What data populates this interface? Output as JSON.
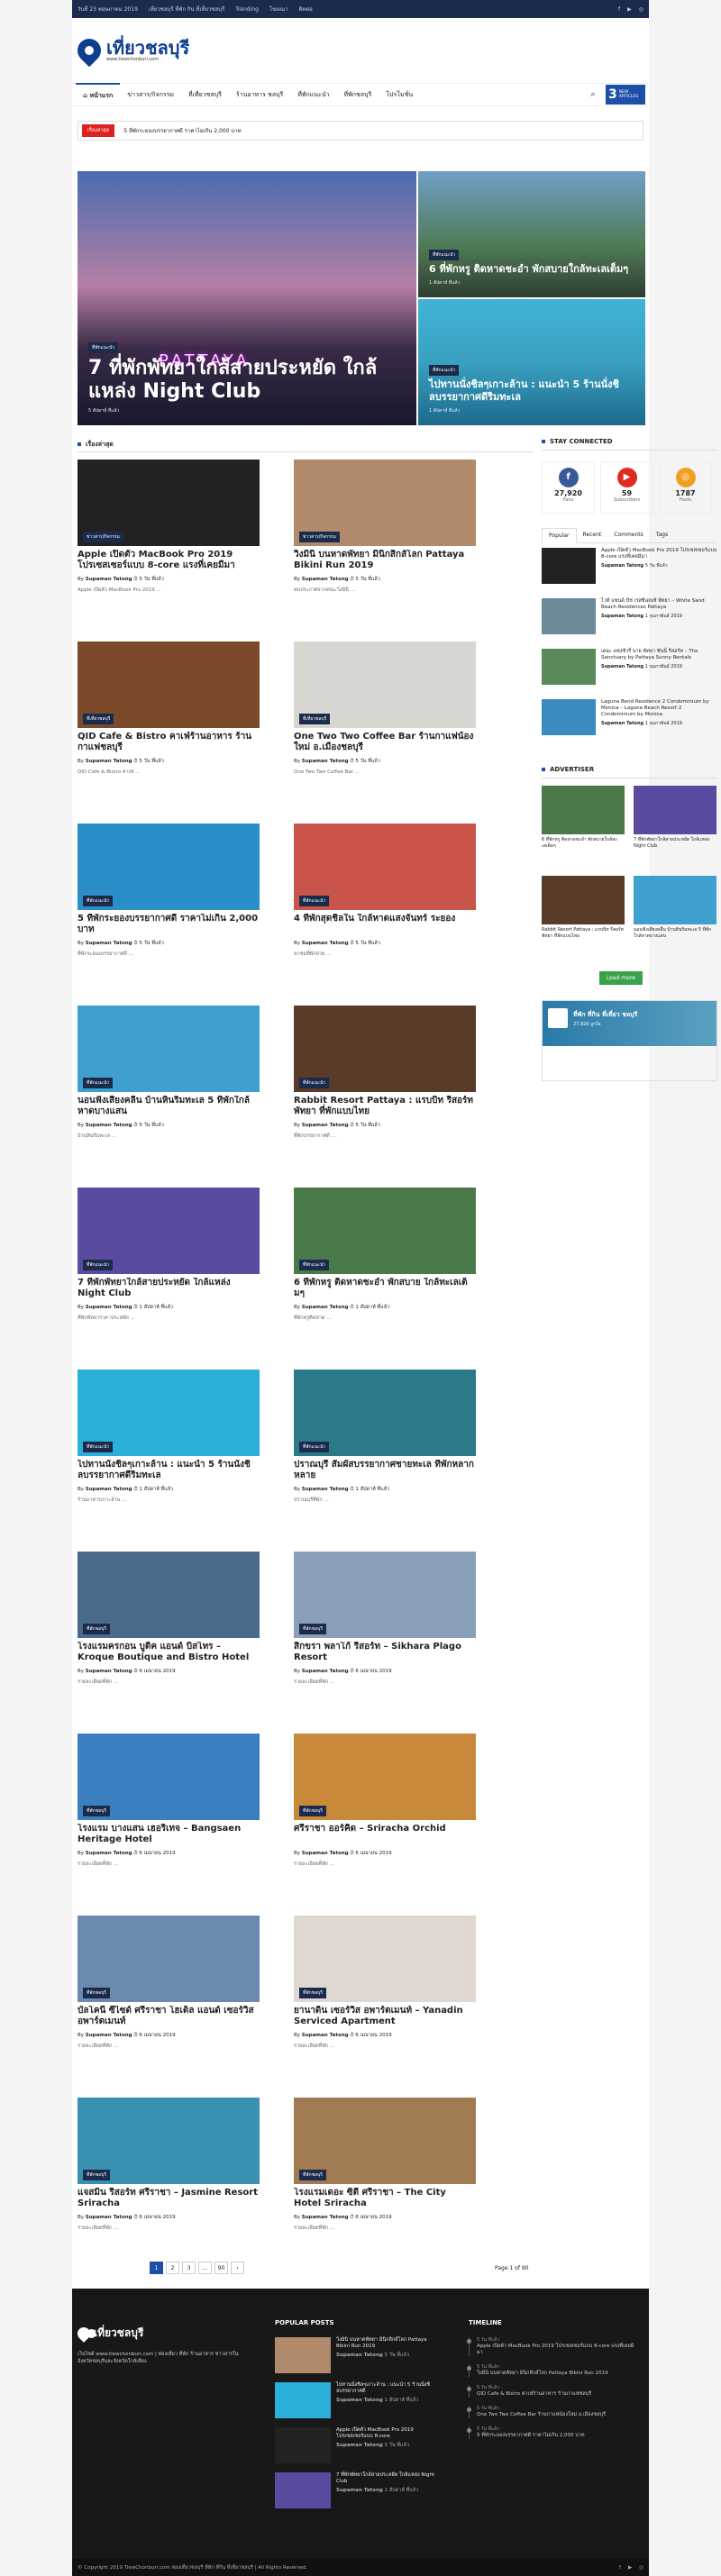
{
  "topbar": {
    "date": "วันที่ 23 พฤษภาคม 2019",
    "tagline": "เที่ยวชลบุรี ที่พัก กิน ที่เที่ยวชลบุรี",
    "trending": "Trending",
    "links": [
      "โฆษณา",
      "ติดต่อ"
    ]
  },
  "logo": {
    "title": "เที่ยวชลบุรี",
    "sub": "www.tiewchonburi.com"
  },
  "nav": {
    "items": [
      "หน้าแรก",
      "ข่าวสาร/กิจกรรม",
      "ที่เที่ยวชลบุรี",
      "ร้านอาหาร ชลบุรี",
      "ที่พักแนะนำ",
      "ที่พักชลบุรี",
      "โปรโมชั่น"
    ],
    "new_count": "3",
    "new_label": "NEW ARTICLES"
  },
  "ticker": {
    "label": "เรื่องล่าสุด",
    "text": "5 ที่พักระยองบรรยากาศดี ราคาไม่เกิน 2,000 บาท"
  },
  "hero": [
    {
      "cat": "ที่พักแนะนำ",
      "title": "7 ที่พักพัทยาใกล้สายประหยัด ใกล้แหล่ง Night Club",
      "meta": "5 สัปดาห์ ที่แล้ว",
      "sign": "PATTAYA"
    },
    {
      "cat": "ที่พักแนะนำ",
      "title": "6 ที่พักหรู ติดหาดชะอำ พักสบายใกล้ทะเลเต็มๆ",
      "meta": "1 สัปดาห์ ที่แล้ว"
    },
    {
      "cat": "ที่พักแนะนำ",
      "title": "ไปทานนั่งชิลๆเกาะล้าน : แนะนำ 5 ร้านนั่งชิลบรรยากาศดีริมทะเล",
      "meta": "1 สัปดาห์ ที่แล้ว"
    }
  ],
  "latest_heading": "เรื่องล่าสุด",
  "posts": [
    {
      "cat": "ข่าวสาร/กิจกรรม",
      "title": "Apple เปิดตัว MacBook Pro 2019 โปรเซสเซอร์แบบ 8-core แรงที่เคยมีมา",
      "author": "Supaman Tatong",
      "date": "5 วัน ที่แล้ว",
      "ex": "Apple เปิดตัว MacBook Pro 2019 ...",
      "bg": "#222"
    },
    {
      "cat": "ข่าวสาร/กิจกรรม",
      "title": "วิ่งมินิ บนหาดพัทยา มินิกสิกส์โลก Pattaya Bikini Run 2019",
      "author": "Supaman Tatong",
      "date": "5 วัน ที่แล้ว",
      "ex": "พบประกาศจากคณะวิ่งมินิ ...",
      "bg": "#b08a6a"
    },
    {
      "cat": "ที่เที่ยวชลบุรี",
      "title": "QID Cafe & Bistro คาเฟ่ร้านอาหาร ร้านกาแฟชลบุรี",
      "author": "Supaman Tatong",
      "date": "5 วัน ที่แล้ว",
      "ex": "QID Cafe & Bistro คาเฟ่ ...",
      "bg": "#7a4a2a"
    },
    {
      "cat": "ที่เที่ยวชลบุรี",
      "title": "One Two Two Coffee Bar ร้านกาแฟน้องใหม่ อ.เมืองชลบุรี",
      "author": "Supaman Tatong",
      "date": "5 วัน ที่แล้ว",
      "ex": "One Two Two Coffee Bar ...",
      "bg": "#d8d6d0"
    },
    {
      "cat": "ที่พักแนะนำ",
      "title": "5 ที่พักระยองบรรยากาศดี ราคาไม่เกิน 2,000 บาท",
      "author": "Supaman Tatong",
      "date": "5 วัน ที่แล้ว",
      "ex": "ที่พักระยองบรรยากาศดี ...",
      "bg": "#2a8fc8"
    },
    {
      "cat": "ที่พักแนะนำ",
      "title": "4 ที่พักสุดชิลใน ใกล้หาดแสงจันทร์ ระยอง",
      "author": "Supaman Tatong",
      "date": "5 วัน ที่แล้ว",
      "ex": "พาชมที่พักสวย ...",
      "bg": "#c9544a"
    },
    {
      "cat": "ที่พักแนะนำ",
      "title": "นอนฟังเสียงคลื่น บ้านหินริมทะเล 5 ที่พักใกล้หาดบางแสน",
      "author": "Supaman Tatong",
      "date": "5 วัน ที่แล้ว",
      "ex": "บ้านหินริมทะเล ...",
      "bg": "#3fa0d0"
    },
    {
      "cat": "ที่พักแนะนำ",
      "title": "Rabbit Resort Pattaya : แรบบิท รีสอร์ท พัทยา ที่พักแบบไทย",
      "author": "Supaman Tatong",
      "date": "5 วัน ที่แล้ว",
      "ex": "ที่พักบรรยากาศดี ...",
      "bg": "#5a3a28"
    },
    {
      "cat": "ที่พักแนะนำ",
      "title": "7 ที่พักพัทยาใกล้สายประหยัด ใกล้แหล่ง Night Club",
      "author": "Supaman Tatong",
      "date": "1 สัปดาห์ ที่แล้ว",
      "ex": "ที่พักพัทยาราคาประหยัด ...",
      "bg": "#5a4aa0"
    },
    {
      "cat": "ที่พักแนะนำ",
      "title": "6 ที่พักหรู ติดหาดชะอำ พักสบาย ใกล้ทะเลเต็มๆ",
      "author": "Supaman Tatong",
      "date": "1 สัปดาห์ ที่แล้ว",
      "ex": "ที่พักหรูติดหาด ...",
      "bg": "#4a7a4a"
    },
    {
      "cat": "ที่พักแนะนำ",
      "title": "ไปทานนั่งชิลๆเกาะล้าน : แนะนำ 5 ร้านนั่งชิลบรรยากาศดีริมทะเล",
      "author": "Supaman Tatong",
      "date": "1 สัปดาห์ ที่แล้ว",
      "ex": "ร้านอาหารเกาะล้าน ...",
      "bg": "#2ab0d8"
    },
    {
      "cat": "ที่พักแนะนำ",
      "title": "ปราณบุรี สัมผัสบรรยากาศชายทะเล ที่พักหลากหลาย",
      "author": "Supaman Tatong",
      "date": "1 สัปดาห์ ที่แล้ว",
      "ex": "ปราณบุรีที่พัก ...",
      "bg": "#2a7a8a"
    },
    {
      "cat": "ที่พักชลบุรี",
      "title": "โรงแรมครกอน บูติค แอนด์ บิสโทร – Kroque Boutique and Bistro Hotel",
      "author": "Supaman Tatong",
      "date": "6 เมษายน 2019",
      "ex": "รายละเอียดที่พัก ...",
      "bg": "#4a6a8a"
    },
    {
      "cat": "ที่พักชลบุรี",
      "title": "สิกขรา พลาโก้ รีสอร์ท – Sikhara Plago Resort",
      "author": "Supaman Tatong",
      "date": "6 เมษายน 2019",
      "ex": "รายละเอียดที่พัก ...",
      "bg": "#8aa0b8"
    },
    {
      "cat": "ที่พักชลบุรี",
      "title": "โรงแรม บางแสน เฮอริเทจ – Bangsaen Heritage Hotel",
      "author": "Supaman Tatong",
      "date": "6 เมษายน 2019",
      "ex": "รายละเอียดที่พัก ...",
      "bg": "#3a80c0"
    },
    {
      "cat": "ที่พักชลบุรี",
      "title": "ศรีราชา ออร์คิด – Sriracha Orchid",
      "author": "Supaman Tatong",
      "date": "6 เมษายน 2019",
      "ex": "รายละเอียดที่พัก ...",
      "bg": "#c88a3a"
    },
    {
      "cat": "ที่พักชลบุรี",
      "title": "บัลโคนี ซีไซด์ ศรีราชา โฮเต็ล แอนด์ เซอร์วิส อพาร์ตเมนท์",
      "author": "Supaman Tatong",
      "date": "6 เมษายน 2019",
      "ex": "รายละเอียดที่พัก ...",
      "bg": "#6a8ab0"
    },
    {
      "cat": "ที่พักชลบุรี",
      "title": "ยานาดิน เซอร์วิส อพาร์ตเมนท์ – Yanadin Serviced Apartment",
      "author": "Supaman Tatong",
      "date": "6 เมษายน 2019",
      "ex": "รายละเอียดที่พัก ...",
      "bg": "#e0d8d0"
    },
    {
      "cat": "ที่พักชลบุรี",
      "title": "แจสมิน รีสอร์ท ศรีราชา – Jasmine Resort Sriracha",
      "author": "Supaman Tatong",
      "date": "6 เมษายน 2019",
      "ex": "รายละเอียดที่พัก ...",
      "bg": "#3a90b0"
    },
    {
      "cat": "ที่พักชลบุรี",
      "title": "โรงแรมเดอะ ซิตี้ ศรีราชา – The City Hotel Sriracha",
      "author": "Supaman Tatong",
      "date": "6 เมษายน 2019",
      "ex": "รายละเอียดที่พัก ...",
      "bg": "#a07a50"
    }
  ],
  "sidebar": {
    "heading": "STAY CONNECTED",
    "counts": [
      {
        "n": "27,920",
        "l": "Fans",
        "i": "f",
        "c": "#3b5998"
      },
      {
        "n": "59",
        "l": "Subscribers",
        "i": "▶",
        "c": "#e02a20"
      },
      {
        "n": "1787",
        "l": "Posts",
        "i": "◎",
        "c": "#f0a020"
      }
    ],
    "tabs": [
      "Popular",
      "Recent",
      "Comments",
      "Tags"
    ],
    "popular": [
      {
        "t": "Apple เปิดตัว MacBook Pro 2019 โปรเซสเซอร์แบบ 8-core แรงที่เคยมีมา",
        "a": "Supaman Tatong",
        "d": "5 วัน ที่แล้ว",
        "bg": "#222"
      },
      {
        "t": "ไวท์ แซนด์ บีช เรสซิเดนซ์ พัทยา – White Sand Beach Residences Pattaya",
        "a": "Supaman Tatong",
        "d": "1 กุมภาพันธ์ 2019",
        "bg": "#6a8a9a"
      },
      {
        "t": "เดอะ แซงชัวรี่ บาย พัทยา ซันนี่ รีสอร์ท – The Sanctuary by Pattaya Sunny Rentals",
        "a": "Supaman Tatong",
        "d": "1 กุมภาพันธ์ 2019",
        "bg": "#5a8a5a"
      },
      {
        "t": "Laguna Bend Residence 2 Condominium by Monica – Laguna Beach Resort 2 Condominium by Monica",
        "a": "Supaman Tatong",
        "d": "1 กุมภาพันธ์ 2019",
        "bg": "#3a8ac0"
      }
    ],
    "ads_heading": "ADVERTISER",
    "ads": [
      {
        "t": "6 ที่พักหรู ติดหาดชะอำ พักสบายใกล้ทะเลเต็มๆ",
        "bg": "#4a7a4a"
      },
      {
        "t": "7 ที่พักพัทยาใกล้สายประหยัด ใกล้แหล่ง Night Club",
        "bg": "#5a4aa0"
      },
      {
        "t": "Rabbit Resort Pattaya : แรบบิท รีสอร์ท พัทยา ที่พักแบบไทย",
        "bg": "#5a3a28"
      },
      {
        "t": "นอนฟังเสียงคลื่น บ้านหินริมทะเล 5 ที่พักใกล้หาดบางแสน",
        "bg": "#3fa0d0"
      }
    ],
    "load_more": "Load more",
    "fb_name": "ที่พัก ที่กิน ที่เที่ยว ชลบุรี",
    "fb_likes": "27,920 ถูกใจ"
  },
  "pagination": {
    "pages": [
      "1",
      "2",
      "3",
      "...",
      "90",
      "›"
    ],
    "label": "Page 1 of 90"
  },
  "footer": {
    "logo": "เที่ยวชลบุรี",
    "about": "เว็บไซต์ www.tiewchonburi.com | ท่องเที่ยว ที่พัก ร้านอาหาร ข่าวสารในจังหวัดชลบุรีและจังหวัดใกล้เคียง",
    "popular_heading": "POPULAR POSTS",
    "popular": [
      {
        "t": "วิ่งมินิ บนหาดพัทยา มินิกสิกส์โลก Pattaya Bikini Run 2019",
        "a": "Supaman Tatong",
        "d": "5 วัน ที่แล้ว",
        "bg": "#b08a6a"
      },
      {
        "t": "ไปทานนั่งชิลๆเกาะล้าน : แนะนำ 5 ร้านนั่งชิลบรรยากาศดี",
        "a": "Supaman Tatong",
        "d": "1 สัปดาห์ ที่แล้ว",
        "bg": "#2ab0d8"
      },
      {
        "t": "Apple เปิดตัว MacBook Pro 2019 โปรเซสเซอร์แบบ 8-core",
        "a": "Supaman Tatong",
        "d": "5 วัน ที่แล้ว",
        "bg": "#222"
      },
      {
        "t": "7 ที่พักพัทยาใกล้สายประหยัด ใกล้แหล่ง Night Club",
        "a": "Supaman Tatong",
        "d": "1 สัปดาห์ ที่แล้ว",
        "bg": "#5a4aa0"
      }
    ],
    "timeline_heading": "TIMELINE",
    "timeline": [
      {
        "d": "5 วัน ที่แล้ว",
        "t": "Apple เปิดตัว MacBook Pro 2019 โปรเซสเซอร์แบบ 8-core แรงที่เคยมีมา"
      },
      {
        "d": "5 วัน ที่แล้ว",
        "t": "วิ่งมินิ บนหาดพัทยา มินิกสิกส์โลก Pattaya Bikini Run 2019"
      },
      {
        "d": "5 วัน ที่แล้ว",
        "t": "QID Cafe & Bistro คาเฟ่ร้านอาหาร ร้านกาแฟชลบุรี"
      },
      {
        "d": "5 วัน ที่แล้ว",
        "t": "One Two Two Coffee Bar ร้านกาแฟน้องใหม่ อ.เมืองชลบุรี"
      },
      {
        "d": "5 วัน ที่แล้ว",
        "t": "5 ที่พักระยองบรรยากาศดี ราคาไม่เกิน 2,000 บาท"
      }
    ],
    "copyright": "© Copyright 2019 TiewChonburi.com ท่องเที่ยวชลบุรี ที่พัก ที่กิน ที่เที่ยวชลบุรี | All Rights Reserved."
  }
}
